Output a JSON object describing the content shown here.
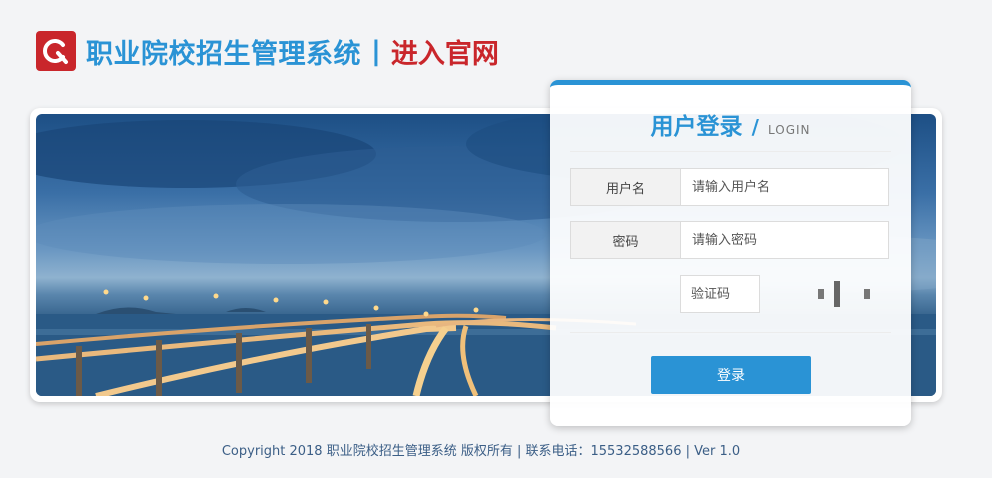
{
  "header": {
    "logo_icon": "brand-logo-icon",
    "title": "职业院校招生管理系统",
    "separator": "|",
    "subtitle": "进入官网",
    "colors": {
      "primary": "#2a93d5",
      "accent": "#c9262b"
    }
  },
  "banner": {
    "image": "bridge-night-scene"
  },
  "login": {
    "title": "用户登录",
    "slash": "/",
    "title_en": "LOGIN",
    "username": {
      "label": "用户名",
      "placeholder": "请输入用户名",
      "value": ""
    },
    "password": {
      "label": "密码",
      "placeholder": "请输入密码",
      "value": ""
    },
    "captcha": {
      "placeholder": "验证码",
      "value": ""
    },
    "submit_label": "登录"
  },
  "footer": {
    "text": "Copyright 2018 职业院校招生管理系统 版权所有 | 联系电话：15532588566 | Ver 1.0"
  }
}
